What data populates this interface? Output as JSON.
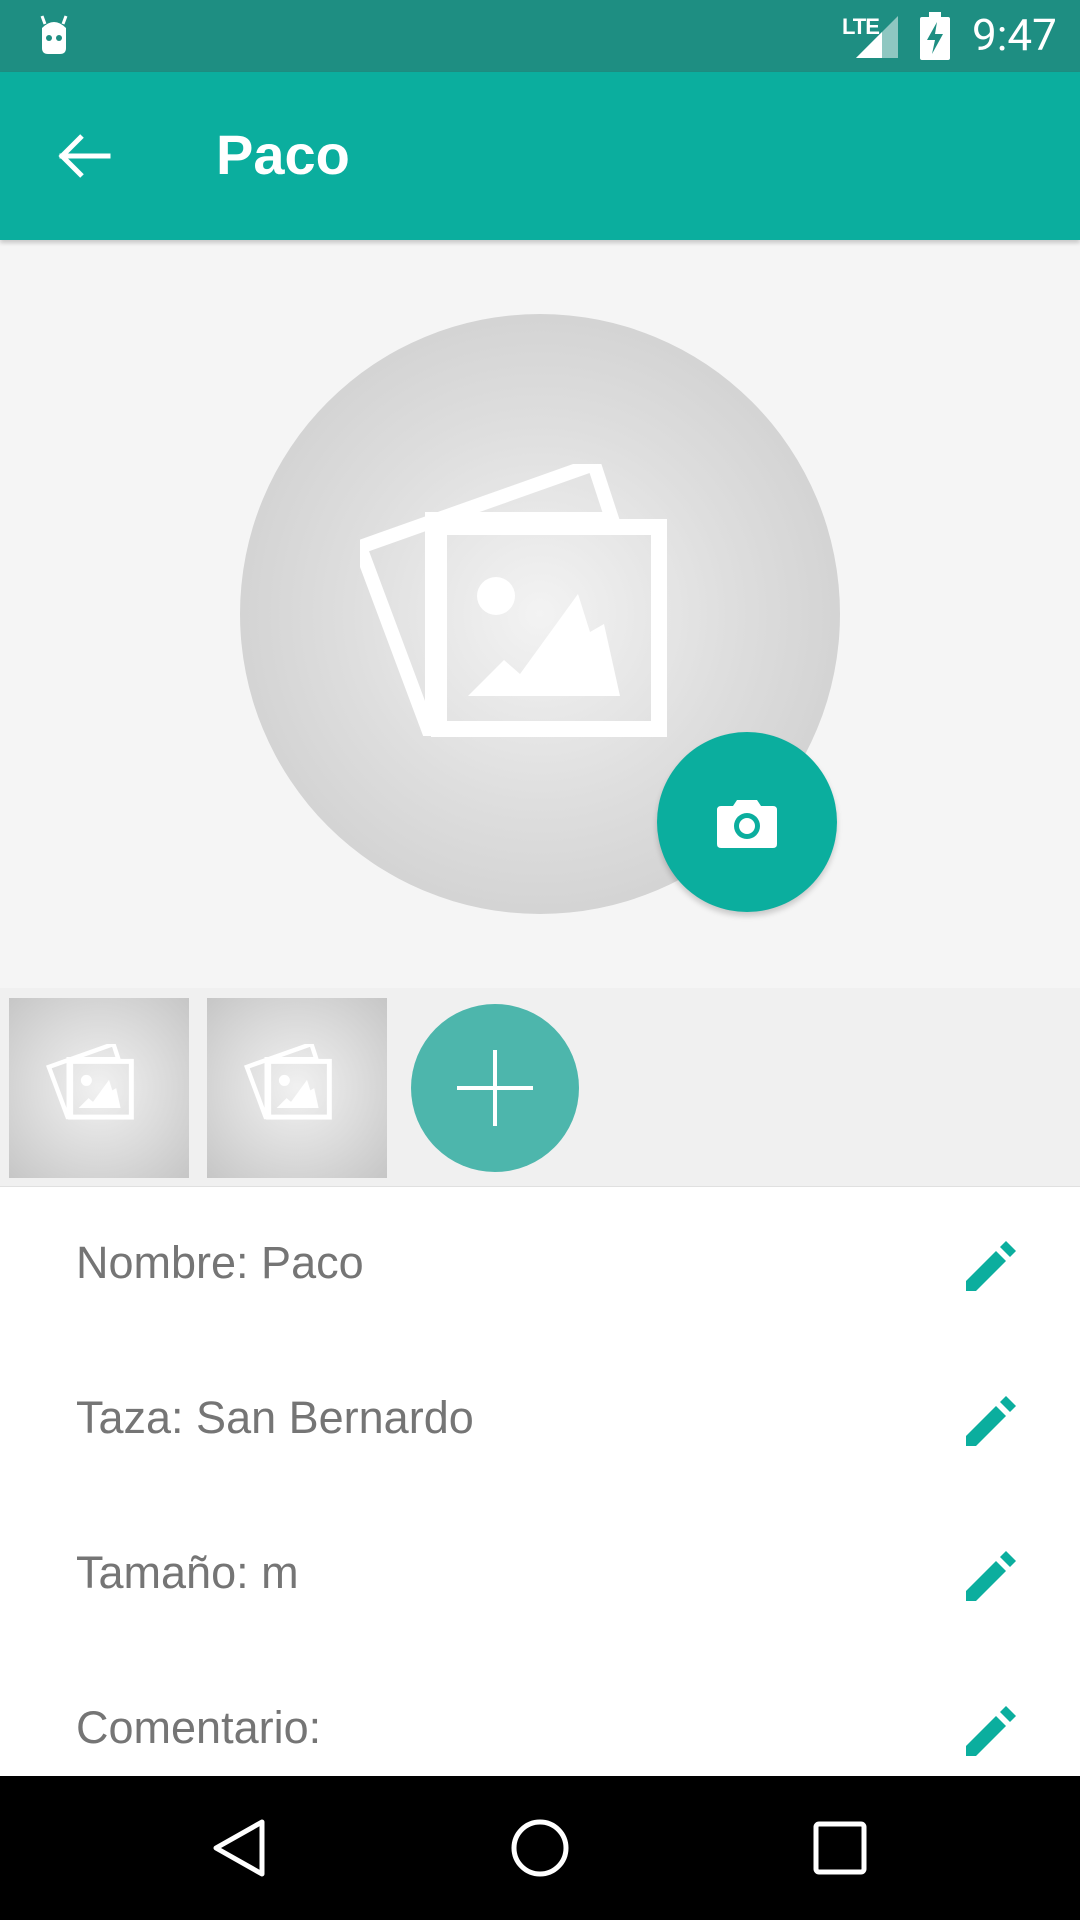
{
  "status_bar": {
    "time": "9:47",
    "network": "LTE",
    "icons": [
      "android-icon",
      "lte-signal-icon",
      "battery-charging-icon"
    ]
  },
  "app_bar": {
    "title": "Paco",
    "back_icon": "arrow-back-icon"
  },
  "profile_photo": {
    "placeholder_icon": "image-placeholder-icon",
    "fab_icon": "camera-icon"
  },
  "gallery": {
    "thumbnails": [
      {
        "icon": "image-placeholder-icon"
      },
      {
        "icon": "image-placeholder-icon"
      }
    ],
    "add_icon": "plus-icon"
  },
  "details": {
    "rows": [
      {
        "label": "Nombre: Paco",
        "edit_icon": "pencil-icon"
      },
      {
        "label": "Taza: San Bernardo",
        "edit_icon": "pencil-icon"
      },
      {
        "label": "Tamaño: m",
        "edit_icon": "pencil-icon"
      },
      {
        "label": "Comentario:",
        "edit_icon": "pencil-icon"
      }
    ]
  },
  "nav_bar": {
    "icons": [
      "back-triangle-icon",
      "home-circle-icon",
      "recents-square-icon"
    ]
  },
  "colors": {
    "status_bar": "#1e8e82",
    "primary": "#0bae9e",
    "add_fab": "#4db6ac",
    "label_text": "#757575",
    "hero_bg": "#f5f5f5",
    "nav_bar": "#000000"
  }
}
